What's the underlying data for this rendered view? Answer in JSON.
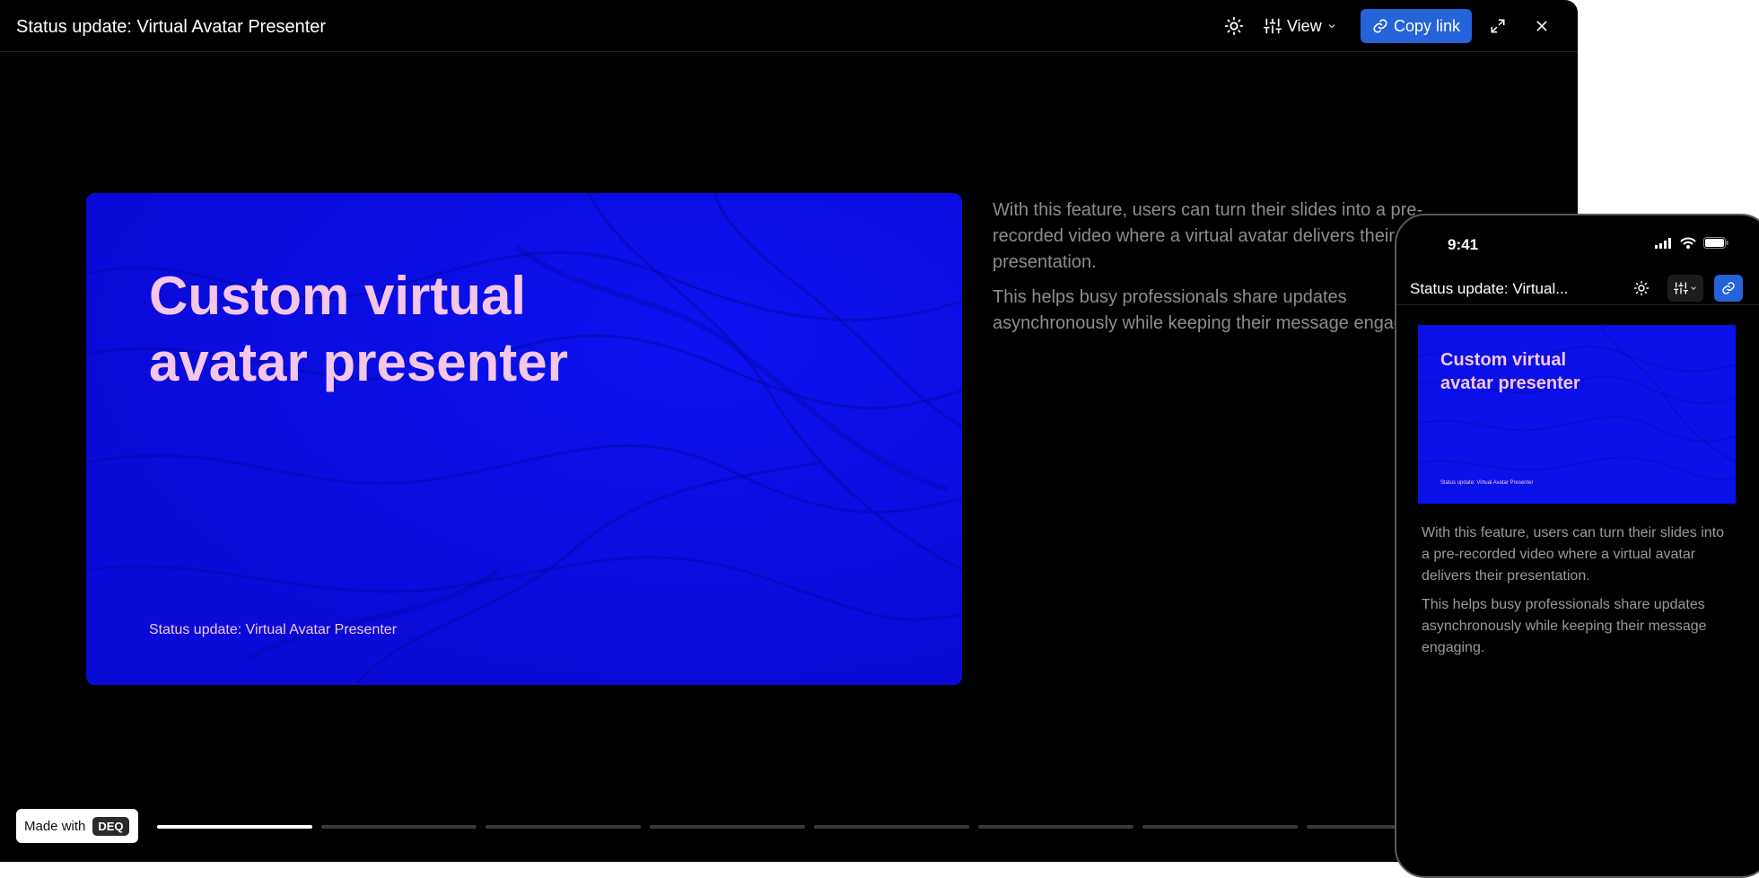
{
  "desktop": {
    "title": "Status update: Virtual Avatar Presenter",
    "toolbar": {
      "theme_icon": "sun-icon",
      "view_label": "View",
      "copy_link_label": "Copy link",
      "fullscreen_icon": "expand-icon",
      "close_icon": "close-icon"
    },
    "slide": {
      "title_line1": "Custom virtual",
      "title_line2": "avatar presenter",
      "footer": "Status update: Virtual Avatar Presenter"
    },
    "notes": [
      "With this feature, users can turn their slides into a pre-recorded video where a virtual avatar delivers their presentation.",
      "This helps busy professionals share updates asynchronously while keeping their message engaging."
    ],
    "badge": {
      "made_with": "Made with",
      "brand": "DEQ"
    },
    "progress": {
      "current": 1,
      "total": 8
    }
  },
  "phone": {
    "time": "9:41",
    "title": "Status update: Virtual...",
    "slide": {
      "title_line1": "Custom virtual",
      "title_line2": "avatar presenter",
      "footer": "Status update: Virtual Avatar Presenter"
    },
    "notes": [
      "With this feature, users can turn their slides into a pre-recorded video where a virtual avatar delivers their presentation.",
      "This helps busy professionals share updates asynchronously while keeping their message engaging."
    ]
  },
  "colors": {
    "accent": "#2563d8",
    "slide_bg": "#0a0fe6",
    "slide_text": "#f3c6ea",
    "notes_text": "#8d8d8d"
  }
}
